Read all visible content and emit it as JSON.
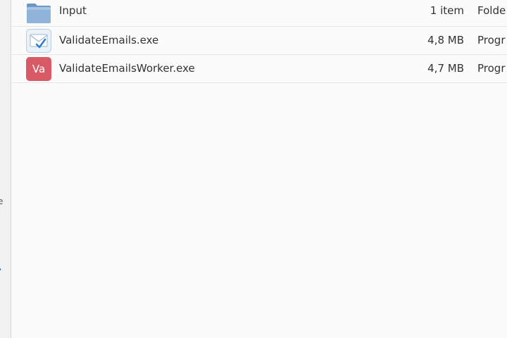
{
  "files": [
    {
      "name": "Input",
      "size": "1 item",
      "type": "Folde",
      "icon": "folder-icon"
    },
    {
      "name": "ValidateEmails.exe",
      "size": "4,8 MB",
      "type": "Progr",
      "icon": "email-check-icon"
    },
    {
      "name": "ValidateEmailsWorker.exe",
      "size": "4,7 MB",
      "type": "Progr",
      "icon": "va-app-icon",
      "icon_text": "Va"
    }
  ],
  "sidebar": {
    "glyph_1": "e",
    "glyph_2": "•"
  },
  "colors": {
    "folder": "#7fa6cf",
    "va_badge": "#d85a66",
    "background": "#fbfbfb"
  }
}
